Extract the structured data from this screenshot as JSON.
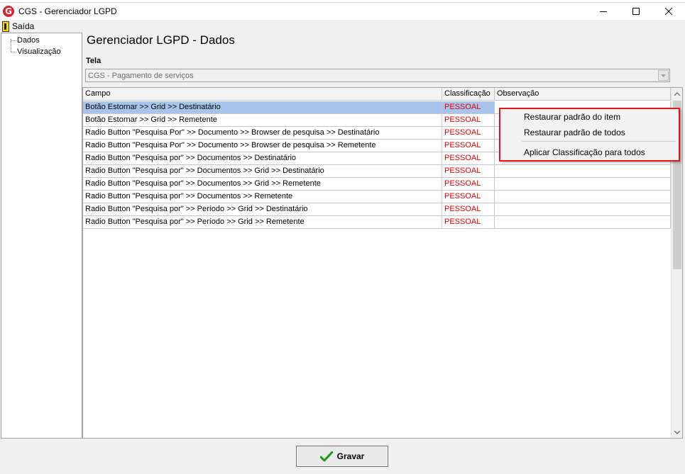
{
  "window": {
    "title": "CGS - Gerenciador LGPD",
    "logo_letter": "G"
  },
  "menu": {
    "exit_label": "Saída"
  },
  "tree": {
    "items": [
      "Dados",
      "Visualização"
    ]
  },
  "page": {
    "title": "Gerenciador LGPD - Dados",
    "tela_label": "Tela",
    "tela_value": "CGS - Pagamento de serviços"
  },
  "grid": {
    "columns": [
      "Campo",
      "Classificação",
      "Observação"
    ],
    "rows": [
      {
        "campo": "Botão Estornar >> Grid >> Destinatário",
        "classificacao": "PESSOAL",
        "observacao": ""
      },
      {
        "campo": "Botão Estornar >> Grid >> Remetente",
        "classificacao": "PESSOAL",
        "observacao": ""
      },
      {
        "campo": "Radio Button \"Pesquisa Por\" >> Documento >> Browser de pesquisa >> Destinatário",
        "classificacao": "PESSOAL",
        "observacao": ""
      },
      {
        "campo": "Radio Button \"Pesquisa Por\" >> Documento >> Browser de pesquisa >> Remetente",
        "classificacao": "PESSOAL",
        "observacao": ""
      },
      {
        "campo": "Radio Button \"Pesquisa por\" >> Documentos >> Destinatário",
        "classificacao": "PESSOAL",
        "observacao": ""
      },
      {
        "campo": "Radio Button \"Pesquisa por\" >> Documentos >> Grid >> Destinatário",
        "classificacao": "PESSOAL",
        "observacao": ""
      },
      {
        "campo": "Radio Button \"Pesquisa por\" >> Documentos >> Grid >> Remetente",
        "classificacao": "PESSOAL",
        "observacao": ""
      },
      {
        "campo": "Radio Button \"Pesquisa por\" >> Documentos >> Remetente",
        "classificacao": "PESSOAL",
        "observacao": ""
      },
      {
        "campo": "Radio Button \"Pesquisa por\" >> Período >> Grid >> Destinatário",
        "classificacao": "PESSOAL",
        "observacao": ""
      },
      {
        "campo": "Radio Button \"Pesquisa por\" >> Período >> Grid >> Remetente",
        "classificacao": "PESSOAL",
        "observacao": ""
      }
    ]
  },
  "context_menu": {
    "items": [
      "Restaurar padrão do item",
      "Restaurar padrão de todos",
      "Aplicar Classificação para todos"
    ]
  },
  "footer": {
    "save_label": "Gravar"
  },
  "colors": {
    "selected_row": "#a8c4ec",
    "classification_text": "#e00000",
    "context_menu_border": "#e8141b",
    "save_check": "#1a9a1a"
  },
  "icons": {
    "app": "cgs-logo-icon",
    "exit": "exit-door-icon",
    "save": "checkmark-icon"
  }
}
